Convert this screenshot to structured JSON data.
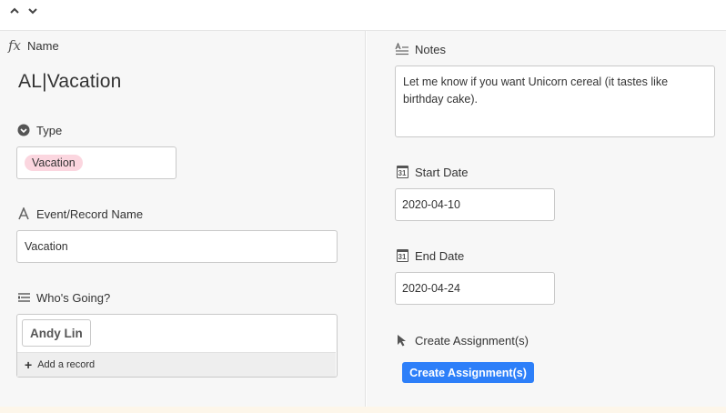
{
  "fields": {
    "name": {
      "label": "Name",
      "value": "AL|Vacation"
    },
    "type": {
      "label": "Type",
      "value": "Vacation",
      "pill_color": "#fbd6df"
    },
    "event_record_name": {
      "label": "Event/Record Name",
      "value": "Vacation"
    },
    "whos_going": {
      "label": "Who's Going?",
      "records": [
        "Andy Lin"
      ],
      "add_label": "Add a record"
    },
    "notes": {
      "label": "Notes",
      "value": "Let me know if you want Unicorn cereal (it tastes like birthday cake)."
    },
    "start_date": {
      "label": "Start Date",
      "value": "2020-04-10",
      "icon_text": "31"
    },
    "end_date": {
      "label": "End Date",
      "value": "2020-04-24",
      "icon_text": "31"
    },
    "create_assignments": {
      "label": "Create Assignment(s)",
      "button_label": "Create Assignment(s)",
      "button_color": "#2d7ff9"
    }
  }
}
